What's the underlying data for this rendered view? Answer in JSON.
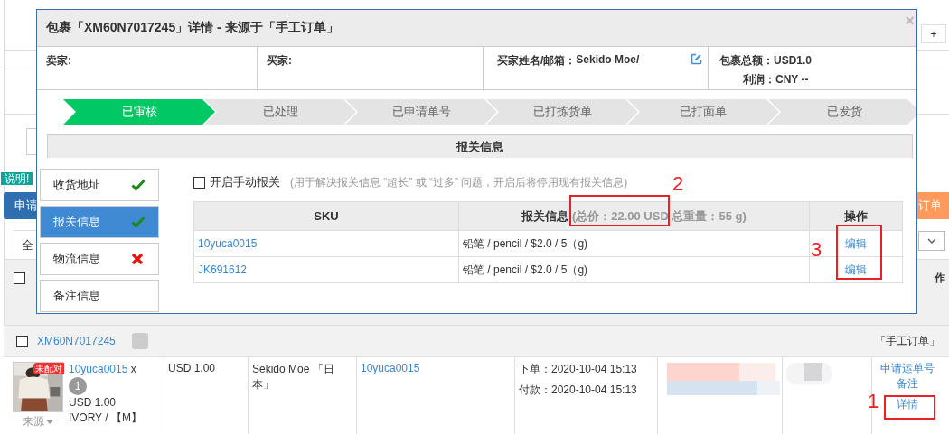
{
  "background": {
    "notice": "说明!",
    "apply_button": "申请",
    "orange_button": "订单",
    "plus_button": "+",
    "tab": "全",
    "header_checked": false,
    "header_fragment": "作",
    "package": {
      "id": "XM60N7017245",
      "source": "「手工订单」",
      "checked": false
    },
    "item": {
      "badge": "未配对",
      "sku_link": "10yuca0015",
      "qty_prefix": "x",
      "qty": "1",
      "price": "USD 1.00",
      "variant": "IVORY / 【M】",
      "source_menu": "来源"
    },
    "amount": "USD 1.00",
    "buyer": "Sekido Moe 「日本」",
    "sku": "10yuca0015",
    "order_time": "下单：2020-10-04 15:13",
    "pay_time": "付款：2020-10-04 15:13",
    "actions": [
      "申请运单号",
      "备注",
      "详情"
    ]
  },
  "modal": {
    "title": "包裹「XM60N7017245」详情 - 来源于「手工订单」",
    "close": "×",
    "seller_label": "卖家:",
    "buyer_label": "买家:",
    "buyer_name_label": "买家姓名/邮箱：",
    "buyer_name": "Sekido Moe/",
    "total_label": "包裹总额：",
    "total": "USD1.0",
    "profit_label": "利润：",
    "profit": "CNY --",
    "steps": [
      {
        "label": "已审核",
        "done": true
      },
      {
        "label": "已处理",
        "done": false
      },
      {
        "label": "已申请单号",
        "done": false
      },
      {
        "label": "已打拣货单",
        "done": false
      },
      {
        "label": "已打面单",
        "done": false
      },
      {
        "label": "已发货",
        "done": false
      }
    ],
    "section_title": "报关信息",
    "side_tabs": [
      {
        "label": "收货地址",
        "selected": false,
        "valid": true
      },
      {
        "label": "报关信息",
        "selected": true,
        "valid": true
      },
      {
        "label": "物流信息",
        "selected": false,
        "valid": false
      },
      {
        "label": "备注信息",
        "selected": false
      }
    ],
    "manual": {
      "checked": false,
      "label": "开启手动报关",
      "hint": "(用于解决报关信息 “超长” 或 “过多” 问题，开启后将停用现有报关信息)"
    },
    "table": {
      "columns": [
        "SKU",
        "报关信息",
        "操作"
      ],
      "summary": "(总价：22.00 USD 总重量：55 g)",
      "rows": [
        {
          "sku": "10yuca0015",
          "info": "铅笔 / pencil / $2.0 / 5（g)",
          "action": "编辑"
        },
        {
          "sku": "JK691612",
          "info": "铅笔 / pencil / $2.0 / 5（g)",
          "action": "编辑"
        }
      ]
    }
  },
  "annotations": [
    "1",
    "2",
    "3"
  ]
}
